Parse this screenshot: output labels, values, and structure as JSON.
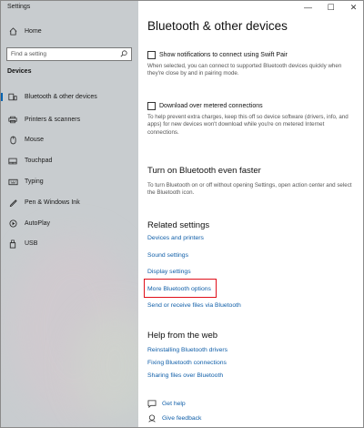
{
  "window": {
    "title": "Settings",
    "controls": [
      "—",
      "☐",
      "✕"
    ]
  },
  "sidebar": {
    "home_label": "Home",
    "search_placeholder": "Find a setting",
    "section_label": "Devices",
    "items": [
      {
        "label": "Bluetooth & other devices",
        "icon": "bluetooth-devices-icon"
      },
      {
        "label": "Printers & scanners",
        "icon": "printer-icon"
      },
      {
        "label": "Mouse",
        "icon": "mouse-icon"
      },
      {
        "label": "Touchpad",
        "icon": "touchpad-icon"
      },
      {
        "label": "Typing",
        "icon": "keyboard-icon"
      },
      {
        "label": "Pen & Windows Ink",
        "icon": "pen-icon"
      },
      {
        "label": "AutoPlay",
        "icon": "autoplay-icon"
      },
      {
        "label": "USB",
        "icon": "usb-icon"
      }
    ]
  },
  "main": {
    "title": "Bluetooth & other devices",
    "swift_pair": {
      "label": "Show notifications to connect using Swift Pair",
      "description": "When selected, you can connect to supported Bluetooth devices quickly when they're close by and in pairing mode."
    },
    "metered": {
      "label": "Download over metered connections",
      "description": "To help prevent extra charges, keep this off so device software (drivers, info, and apps) for new devices won't download while you're on metered Internet connections."
    },
    "faster": {
      "heading": "Turn on Bluetooth even faster",
      "description": "To turn Bluetooth on or off without opening Settings, open action center and select the Bluetooth icon."
    },
    "related": {
      "heading": "Related settings",
      "links": [
        "Devices and printers",
        "Sound settings",
        "Display settings",
        "More Bluetooth options",
        "Send or receive files via Bluetooth"
      ]
    },
    "help": {
      "heading": "Help from the web",
      "links": [
        "Reinstalling Bluetooth drivers",
        "Fixing Bluetooth connections",
        "Sharing files over Bluetooth"
      ]
    },
    "get_help": "Get help",
    "give_feedback": "Give feedback"
  },
  "colors": {
    "link": "#0f5ea8",
    "highlight": "#e0101a",
    "accent": "#0063b1"
  }
}
